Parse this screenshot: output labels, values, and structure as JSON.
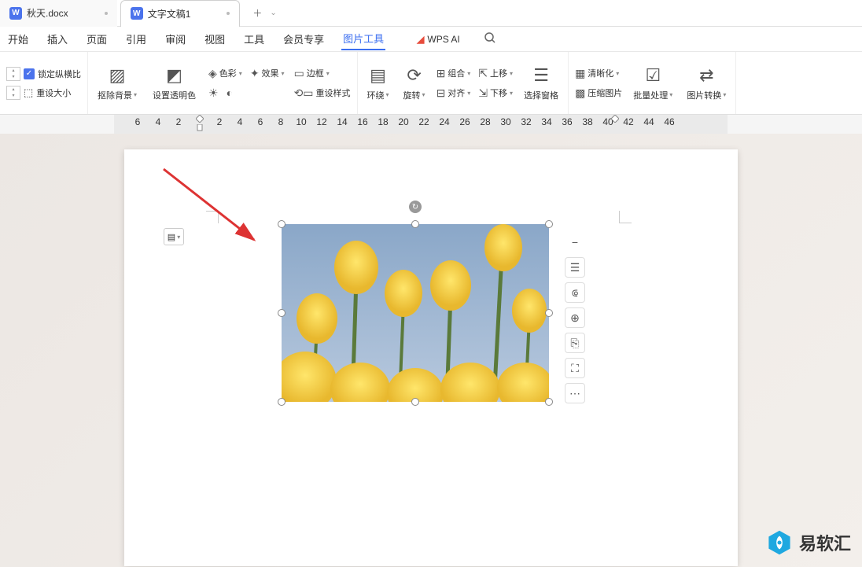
{
  "tabs": {
    "doc1": "秋天.docx",
    "doc2": "文字文稿1",
    "doc2_icon": "W"
  },
  "menu": {
    "items": [
      "开始",
      "插入",
      "页面",
      "引用",
      "审阅",
      "视图",
      "工具",
      "会员专享",
      "图片工具"
    ],
    "active_index": 8,
    "wps_ai": "WPS AI"
  },
  "toolbar": {
    "lock_ratio": "锁定纵横比",
    "reset_size": "重设大小",
    "remove_bg": "抠除背景",
    "set_transparent": "设置透明色",
    "color": "色彩",
    "effect": "效果",
    "border": "边框",
    "reset_style": "重设样式",
    "wrap": "环绕",
    "rotate": "旋转",
    "group": "组合",
    "align": "对齐",
    "move_up": "上移",
    "move_down": "下移",
    "select_pane": "选择窗格",
    "sharpen": "清晰化",
    "compress": "压缩图片",
    "batch": "批量处理",
    "convert": "图片转换"
  },
  "ruler": {
    "values": [
      "6",
      "4",
      "2",
      "",
      "2",
      "4",
      "6",
      "8",
      "10",
      "12",
      "14",
      "16",
      "18",
      "20",
      "22",
      "24",
      "26",
      "28",
      "30",
      "32",
      "34",
      "36",
      "38",
      "40",
      "42",
      "44",
      "46"
    ]
  },
  "side_toolbar": {
    "items": [
      "minus-icon",
      "wrap-options-icon",
      "crop-icon",
      "zoom-icon",
      "copy-icon",
      "fullscreen-icon",
      "more-icon"
    ]
  },
  "watermark": {
    "text": "易软汇"
  }
}
